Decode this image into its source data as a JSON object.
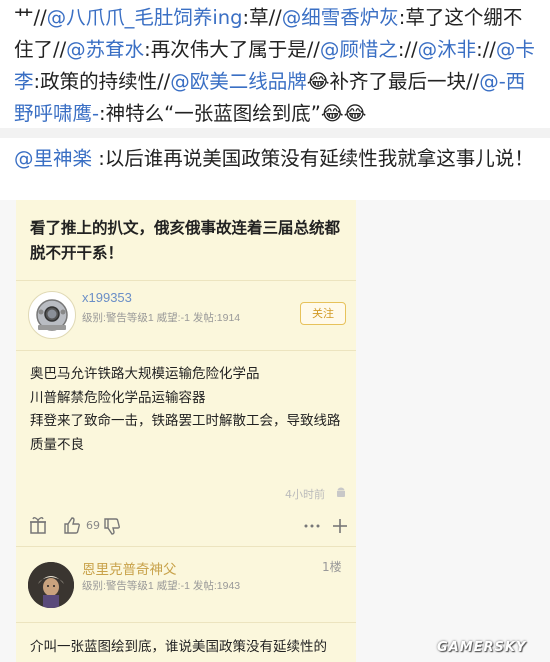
{
  "repost_chain": [
    {
      "type": "text",
      "value": "艹//"
    },
    {
      "type": "mention",
      "value": "@八爪爪_毛肚饲养ing"
    },
    {
      "type": "text",
      "value": ":草//"
    },
    {
      "type": "mention",
      "value": "@细雪香炉灰"
    },
    {
      "type": "text",
      "value": ":草了这个绷不住了//"
    },
    {
      "type": "mention",
      "value": "@苏耷水"
    },
    {
      "type": "text",
      "value": ":再次伟大了属于是//"
    },
    {
      "type": "mention",
      "value": "@顾惜之"
    },
    {
      "type": "text",
      "value": "://"
    },
    {
      "type": "mention",
      "value": "@沐非"
    },
    {
      "type": "text",
      "value": "://"
    },
    {
      "type": "mention",
      "value": "@卡李"
    },
    {
      "type": "text",
      "value": ":政策的持续性//"
    },
    {
      "type": "mention",
      "value": "@欧美二线品牌"
    },
    {
      "type": "emoji",
      "value": "😂"
    },
    {
      "type": "text",
      "value": "补齐了最后一块//"
    },
    {
      "type": "mention",
      "value": "@-西野呼啸鹰-"
    },
    {
      "type": "text",
      "value": ":神特么“一张蓝图绘到底”"
    },
    {
      "type": "emoji",
      "value": "😂😂"
    }
  ],
  "comment": {
    "author": "@里神楽",
    "text": " :以后谁再说美国政策没有延续性我就拿这事儿说！"
  },
  "card": {
    "headline": "看了推上的扒文，俄亥俄事故连着三届总统都脱不开干系！",
    "user1": {
      "name": "x199353",
      "meta": "级别:警告等级1 威望:-1 发帖:1914",
      "follow_label": "关注"
    },
    "post_lines": [
      "奥巴马允许铁路大规模运输危险化学品",
      "川普解禁危险化学品运输容器",
      "拜登来了致命一击，铁路罢工时解散工会，导致线路质量不良"
    ],
    "timestamp": "4小时前",
    "like_count": "69",
    "user2": {
      "name": "恩里克普奇神父",
      "meta": "级别:警告等级1 威望:-1 发帖:1943",
      "floor": "1楼"
    },
    "bottom_text": "介叫一张蓝图绘到底，谁说美国政策没有延续性的"
  },
  "watermark": "GAMERSKY",
  "colors": {
    "link": "#3a6fc4",
    "card_bg": "#fbf7dc",
    "username": "#6b8fc7",
    "follow": "#d29a26"
  }
}
